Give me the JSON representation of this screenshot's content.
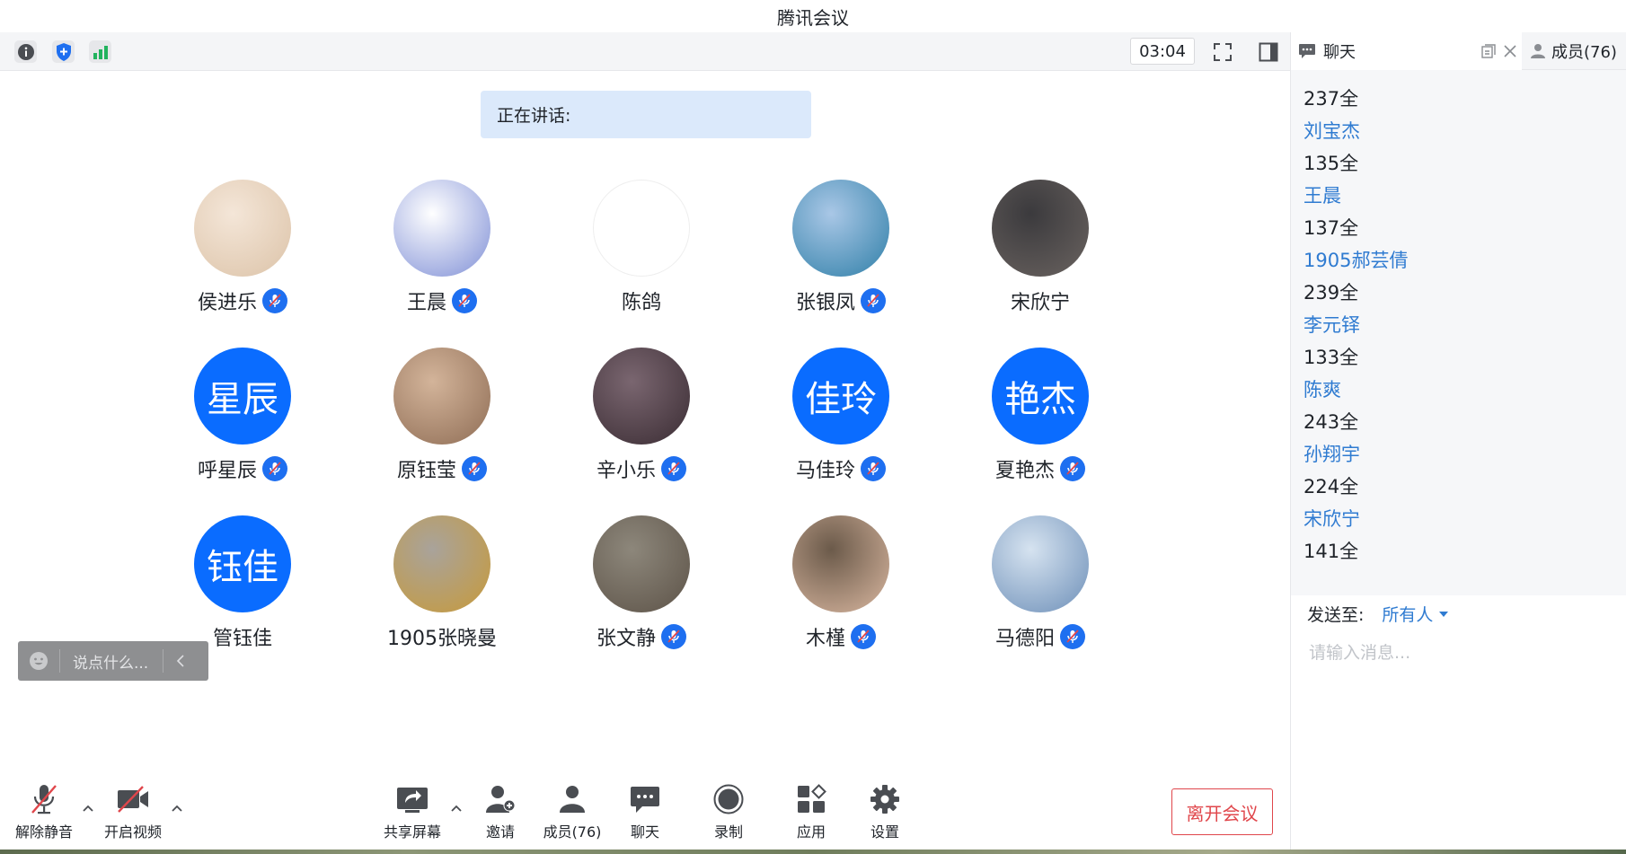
{
  "window": {
    "title": "腾讯会议"
  },
  "topbar": {
    "timer": "03:04",
    "icons": [
      "info-icon",
      "shield-icon",
      "signal-icon",
      "fullscreen-icon",
      "sidebar-toggle-icon"
    ]
  },
  "speaking": {
    "label": "正在讲话:"
  },
  "participants": [
    {
      "name": "侯进乐",
      "avatar_type": "photo",
      "photo_tone": [
        "#f4e6d8",
        "#dcc3a8"
      ],
      "muted": true
    },
    {
      "name": "王晨",
      "avatar_type": "photo",
      "photo_tone": [
        "#ffffff",
        "#7f8fd6"
      ],
      "muted": true
    },
    {
      "name": "陈鸽",
      "avatar_type": "photo",
      "photo_tone": [
        "#ffffff",
        "#ffffff"
      ],
      "muted": false
    },
    {
      "name": "张银凤",
      "avatar_type": "photo",
      "photo_tone": [
        "#a9c7e6",
        "#2f7fa8"
      ],
      "muted": true
    },
    {
      "name": "宋欣宁",
      "avatar_type": "photo",
      "photo_tone": [
        "#3b3a3d",
        "#6a6360"
      ],
      "muted": false
    },
    {
      "name": "呼星辰",
      "avatar_type": "text",
      "avatar_text": "星辰",
      "muted": true
    },
    {
      "name": "原钰莹",
      "avatar_type": "photo",
      "photo_tone": [
        "#d3b49a",
        "#8f6d55"
      ],
      "muted": true
    },
    {
      "name": "辛小乐",
      "avatar_type": "photo",
      "photo_tone": [
        "#7a6670",
        "#3a2c33"
      ],
      "muted": true
    },
    {
      "name": "马佳玲",
      "avatar_type": "text",
      "avatar_text": "佳玲",
      "muted": true
    },
    {
      "name": "夏艳杰",
      "avatar_type": "text",
      "avatar_text": "艳杰",
      "muted": true
    },
    {
      "name": "管钰佳",
      "avatar_type": "text",
      "avatar_text": "钰佳",
      "muted": false
    },
    {
      "name": "1905张晓曼",
      "avatar_type": "photo",
      "photo_tone": [
        "#a9a39b",
        "#c79a3a"
      ],
      "muted": false
    },
    {
      "name": "张文静",
      "avatar_type": "photo",
      "photo_tone": [
        "#8d877b",
        "#5d5348"
      ],
      "muted": true
    },
    {
      "name": "木槿",
      "avatar_type": "photo",
      "photo_tone": [
        "#6b5a4a",
        "#d9b7a0"
      ],
      "muted": true
    },
    {
      "name": "马德阳",
      "avatar_type": "photo",
      "photo_tone": [
        "#d6e3f0",
        "#6d8fb8"
      ],
      "muted": true
    }
  ],
  "quick_comment": {
    "placeholder": "说点什么..."
  },
  "toolbar": {
    "unmute": "解除静音",
    "start_video": "开启视频",
    "share_screen": "共享屏幕",
    "invite": "邀请",
    "members": "成员(76)",
    "chat": "聊天",
    "record": "录制",
    "apps": "应用",
    "settings": "设置",
    "leave": "离开会议"
  },
  "right_panel": {
    "chat_tab": "聊天",
    "members_tab": "成员(76)",
    "messages": [
      {
        "type": "text",
        "value": "237全"
      },
      {
        "type": "sender",
        "value": "刘宝杰"
      },
      {
        "type": "text",
        "value": "135全"
      },
      {
        "type": "sender",
        "value": "王晨"
      },
      {
        "type": "text",
        "value": "137全"
      },
      {
        "type": "sender",
        "value": "1905郝芸倩"
      },
      {
        "type": "text",
        "value": "239全"
      },
      {
        "type": "sender",
        "value": "李元铎"
      },
      {
        "type": "text",
        "value": "133全"
      },
      {
        "type": "sender",
        "value": "陈爽"
      },
      {
        "type": "text",
        "value": "243全"
      },
      {
        "type": "sender",
        "value": "孙翔宇"
      },
      {
        "type": "text",
        "value": "224全"
      },
      {
        "type": "sender",
        "value": "宋欣宁"
      },
      {
        "type": "text",
        "value": "141全"
      }
    ],
    "send_to_label": "发送至:",
    "send_to_value": "所有人",
    "input_placeholder": "请输入消息..."
  },
  "colors": {
    "accent": "#0a6cff",
    "sender_name": "#2f7bd1",
    "leave": "#e0464b",
    "speaking_bg": "#dbe9fb"
  }
}
